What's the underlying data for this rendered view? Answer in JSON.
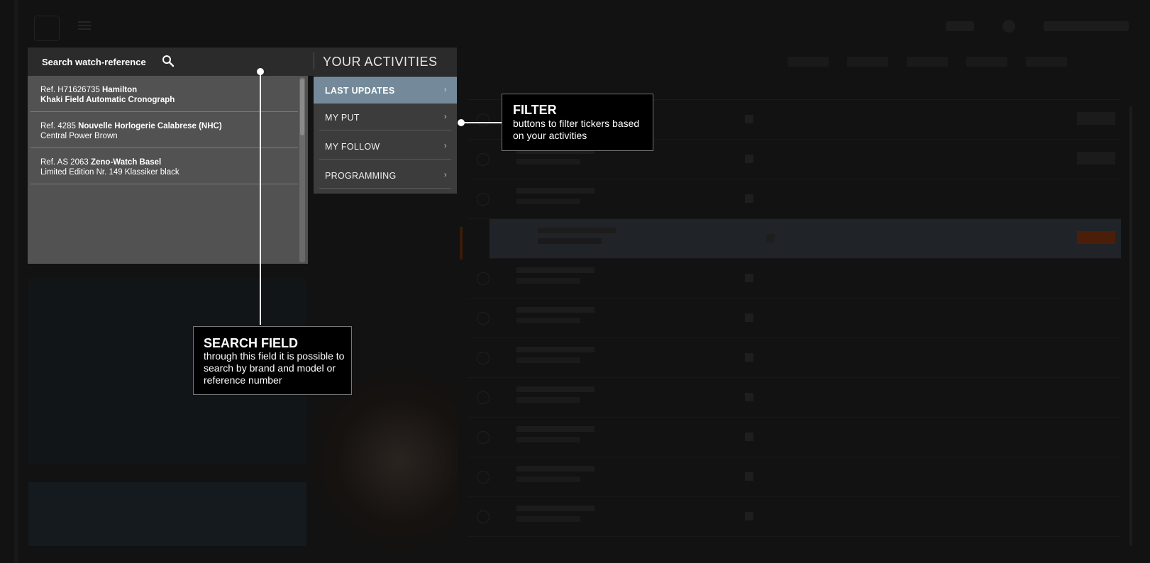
{
  "search": {
    "label": "Search watch-reference",
    "results": [
      {
        "ref": "Ref. H71626735",
        "brand": "Hamilton",
        "model": "Khaki Field Automatic Cronograph"
      },
      {
        "ref": "Ref. 4285",
        "brand": "Nouvelle Horlogerie Calabrese (NHC)",
        "model": "Central Power Brown"
      },
      {
        "ref": "Ref. AS 2063",
        "brand": "Zeno-Watch Basel",
        "model": "Limited Edition Nr. 149 Klassiker black"
      }
    ]
  },
  "activities": {
    "title": "YOUR ACTIVITIES",
    "items": [
      {
        "label": "LAST UPDATES",
        "active": true
      },
      {
        "label": "MY PUT",
        "active": false
      },
      {
        "label": "MY FOLLOW",
        "active": false
      },
      {
        "label": "PROGRAMMING",
        "active": false
      }
    ]
  },
  "callouts": {
    "filter": {
      "title": "FILTER",
      "desc": "buttons to filter tickers based on your activities"
    },
    "search": {
      "title": "SEARCH FIELD",
      "desc": "through this field it is possible to search by brand and model or reference number"
    }
  },
  "colors": {
    "active_menu": "#748a9a",
    "overlay": "#0c0c0c"
  }
}
